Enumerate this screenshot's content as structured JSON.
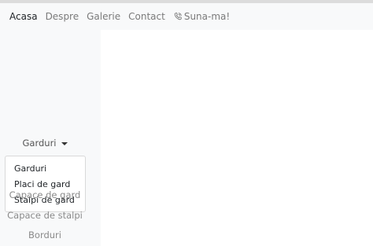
{
  "nav": {
    "links": [
      "Acasa",
      "Despre",
      "Galerie",
      "Contact"
    ],
    "call_label": "Suna-ma!",
    "call_icon": "phone-icon"
  },
  "sidebar": {
    "dropdown_label": "Garduri",
    "dropdown_items": [
      "Garduri",
      "Placi de gard",
      "Stalpi de gard"
    ],
    "items": [
      "Capace de gard",
      "Capace de stalpi",
      "Borduri"
    ]
  },
  "colors": {
    "nav_bg": "#f8f9fa",
    "active_text": "#212529",
    "muted_text": "#7a7a7a"
  }
}
